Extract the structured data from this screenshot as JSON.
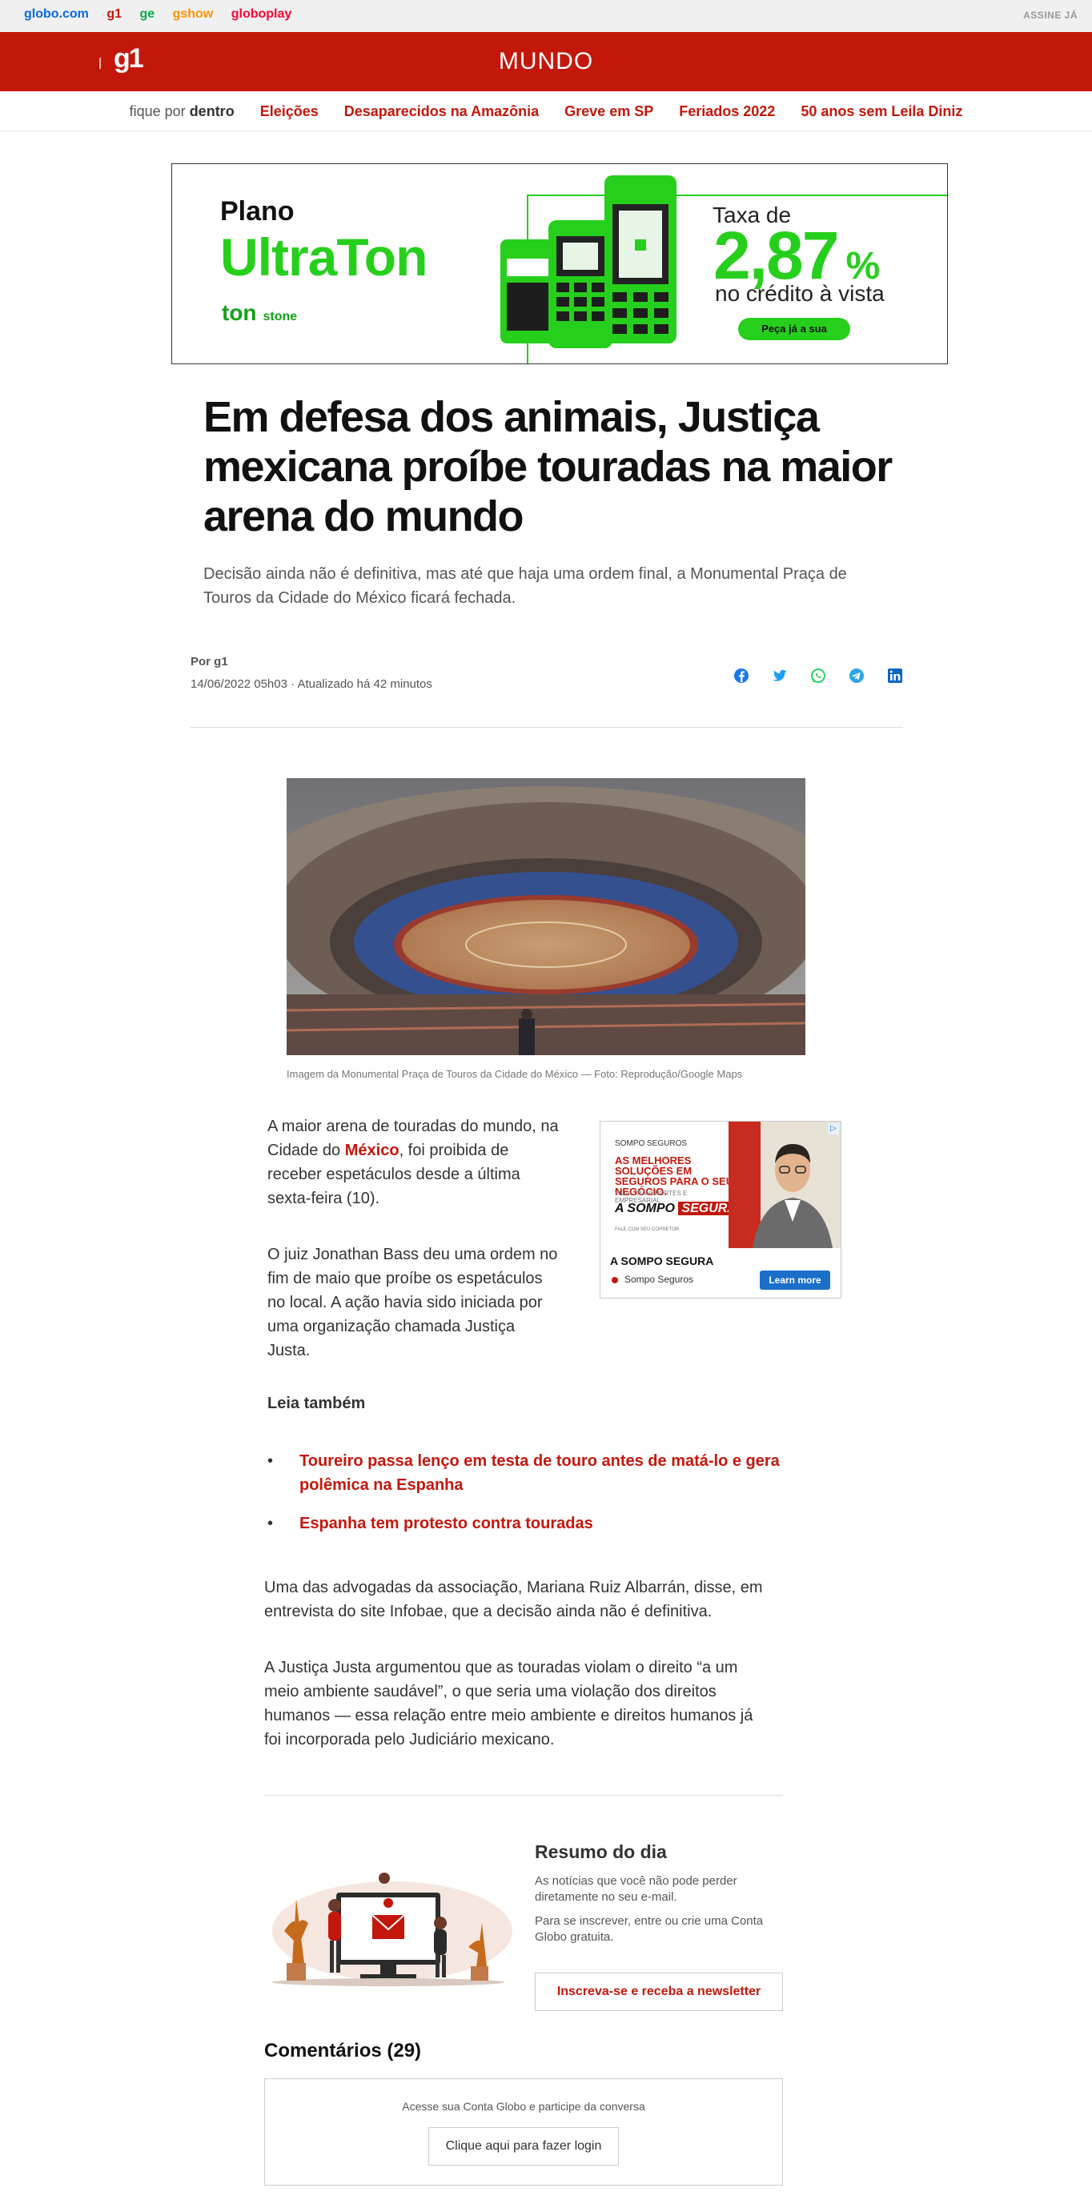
{
  "globo_bar": {
    "brands": [
      {
        "label": "globo.com",
        "color": "#0669de"
      },
      {
        "label": "g1",
        "color": "#c4170c"
      },
      {
        "label": "ge",
        "color": "#06aa48"
      },
      {
        "label": "gshow",
        "color": "#fa9300"
      },
      {
        "label": "globoplay",
        "color": "#fb0234"
      }
    ],
    "assine": "ASSINE JÁ"
  },
  "header": {
    "logo": "g1",
    "section": "MUNDO",
    "accent_color": "#c4170c"
  },
  "menu": {
    "fique_por": "fique por",
    "dentro": "dentro",
    "links": [
      "Eleições",
      "Desaparecidos na Amazônia",
      "Greve em SP",
      "Feriados 2022",
      "50 anos sem Leila Diniz"
    ]
  },
  "ad_top": {
    "plano": "Plano",
    "product": "UltraTon",
    "logo_ton": "ton",
    "logo_stone": "stone",
    "taxa": "Taxa de",
    "rate": "2,87",
    "percent": "%",
    "credito": "no crédito à vista",
    "cta": "Peça já a sua"
  },
  "article": {
    "headline": "Em defesa dos animais, Justiça mexicana proíbe touradas na maior arena do mundo",
    "subtitle": "Decisão ainda não é definitiva, mas até que haja uma ordem final, a Monumental Praça de Touros da Cidade do México ficará fechada.",
    "byline": "Por g1",
    "dates": "14/06/2022 05h03 · Atualizado há 42 minutos",
    "share_icons": [
      "facebook-icon",
      "twitter-icon",
      "whatsapp-icon",
      "telegram-icon",
      "linkedin-icon"
    ],
    "caption": "Imagem da Monumental Praça de Touros da Cidade do México — Foto: Reprodução/Google Maps",
    "p1_a": "A maior arena de touradas do mundo, na Cidade do ",
    "p1_link": "México",
    "p1_b": ", foi proibida de receber espetáculos desde a última sexta-feira (10).",
    "p2": "O juiz Jonathan Bass deu uma ordem no fim de maio que proíbe os espetáculos no local. A ação havia sido iniciada por uma organização chamada Justiça Justa.",
    "leia_tambem": "Leia também",
    "related": [
      "Toureiro passa lenço em testa de touro antes de matá-lo e gera polêmica na Espanha",
      "Espanha tem protesto contra touradas"
    ],
    "p3": "Uma das advogadas da associação, Mariana Ruiz Albarrán, disse, em entrevista do site Infobae, que a decisão ainda não é definitiva.",
    "p4": "A Justiça Justa argumentou que as touradas violam o direito “a um meio ambiente saudável”, o que seria uma violação dos direitos humanos — essa relação entre meio ambiente e direitos humanos já foi incorporada pelo Judiciário mexicano."
  },
  "ad_side": {
    "brand_small": "SOMPO SEGUROS",
    "headline": "AS MELHORES SOLUÇÕES EM SEGUROS PARA O SEU NEGÓCIO.",
    "small": "VIDA, TRANSPORTES E EMPRESARIAL.",
    "stamp_a": "A SOMPO",
    "stamp_b": "SEGURA",
    "tagline": "FALE COM SEU CORRETOR.",
    "name": "A SOMPO SEGURA",
    "sub": "Sompo Seguros",
    "learn_more": "Learn more",
    "adchoice": "▷"
  },
  "newsletter": {
    "title": "Resumo do dia",
    "desc1": "As notícias que você não pode perder diretamente no seu e-mail.",
    "desc2": "Para se inscrever, entre ou crie uma Conta Globo gratuita.",
    "button": "Inscreva-se e receba a newsletter"
  },
  "comments": {
    "title": "Comentários (29)",
    "msg": "Acesse sua Conta Globo e participe da conversa",
    "login": "Clique aqui para fazer login"
  }
}
